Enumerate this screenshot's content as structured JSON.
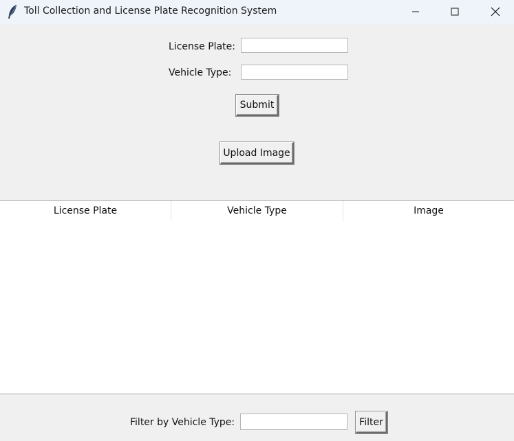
{
  "window": {
    "title": "Toll Collection and License Plate Recognition System",
    "icon": "feather-icon",
    "controls": [
      "minimize-icon",
      "maximize-icon",
      "close-icon"
    ]
  },
  "form": {
    "license_plate_label": "License Plate:",
    "license_plate_value": "",
    "vehicle_type_label": "Vehicle Type:",
    "vehicle_type_value": "",
    "submit_label": "Submit",
    "upload_label": "Upload Image"
  },
  "table": {
    "columns": [
      "License Plate",
      "Vehicle Type",
      "Image"
    ],
    "rows": []
  },
  "filter": {
    "label": "Filter by Vehicle Type:",
    "value": "",
    "button_label": "Filter"
  }
}
